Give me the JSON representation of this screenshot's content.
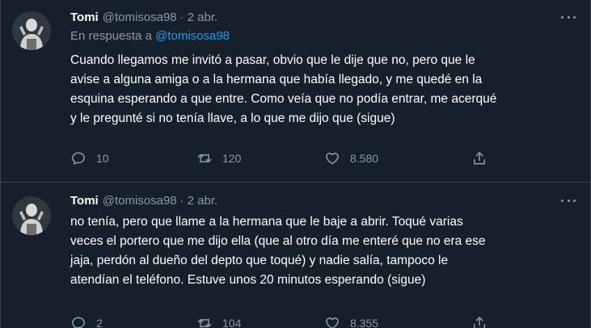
{
  "tweets": [
    {
      "name": "Tomi",
      "handle": "@tomisosa98",
      "separator": "·",
      "date": "2 abr.",
      "reply_prefix": "En respuesta a",
      "reply_mention": "@tomisosa98",
      "lines": [
        "Cuando llegamos me invitó a pasar, obvio que le dije que no, pero que le",
        "avise a alguna amiga o a la hermana que había llegado, y me quedé en la",
        "esquina esperando a que entre. Como veía que no podía entrar, me acerqué",
        "y le pregunté si no tenía llave, a lo que me dijo que (sigue)"
      ],
      "replies": "10",
      "retweets": "120",
      "likes": "8.580"
    },
    {
      "name": "Tomi",
      "handle": "@tomisosa98",
      "separator": "·",
      "date": "2 abr.",
      "lines": [
        "no tenía, pero que llame a la hermana que le baje a abrir. Toqué varias",
        "veces el portero que me dijo ella (que al otro día me enteré que no era ese",
        "jaja, perdón al dueño del depto que toqué) y nadie salía, tampoco le",
        "atendían el teléfono. Estuve unos 20 minutos esperando (sigue)"
      ],
      "replies": "2",
      "retweets": "104",
      "likes": "8.355"
    }
  ],
  "icons": {
    "reply": "speech-bubble-icon",
    "retweet": "retweet-arrows-icon",
    "like": "heart-icon",
    "share": "upload-share-icon",
    "more": "more-dots-icon"
  },
  "colors": {
    "background": "#15202b",
    "secondary_text": "#8899a6",
    "link": "#1d9bf0",
    "divider": "#38444d"
  }
}
